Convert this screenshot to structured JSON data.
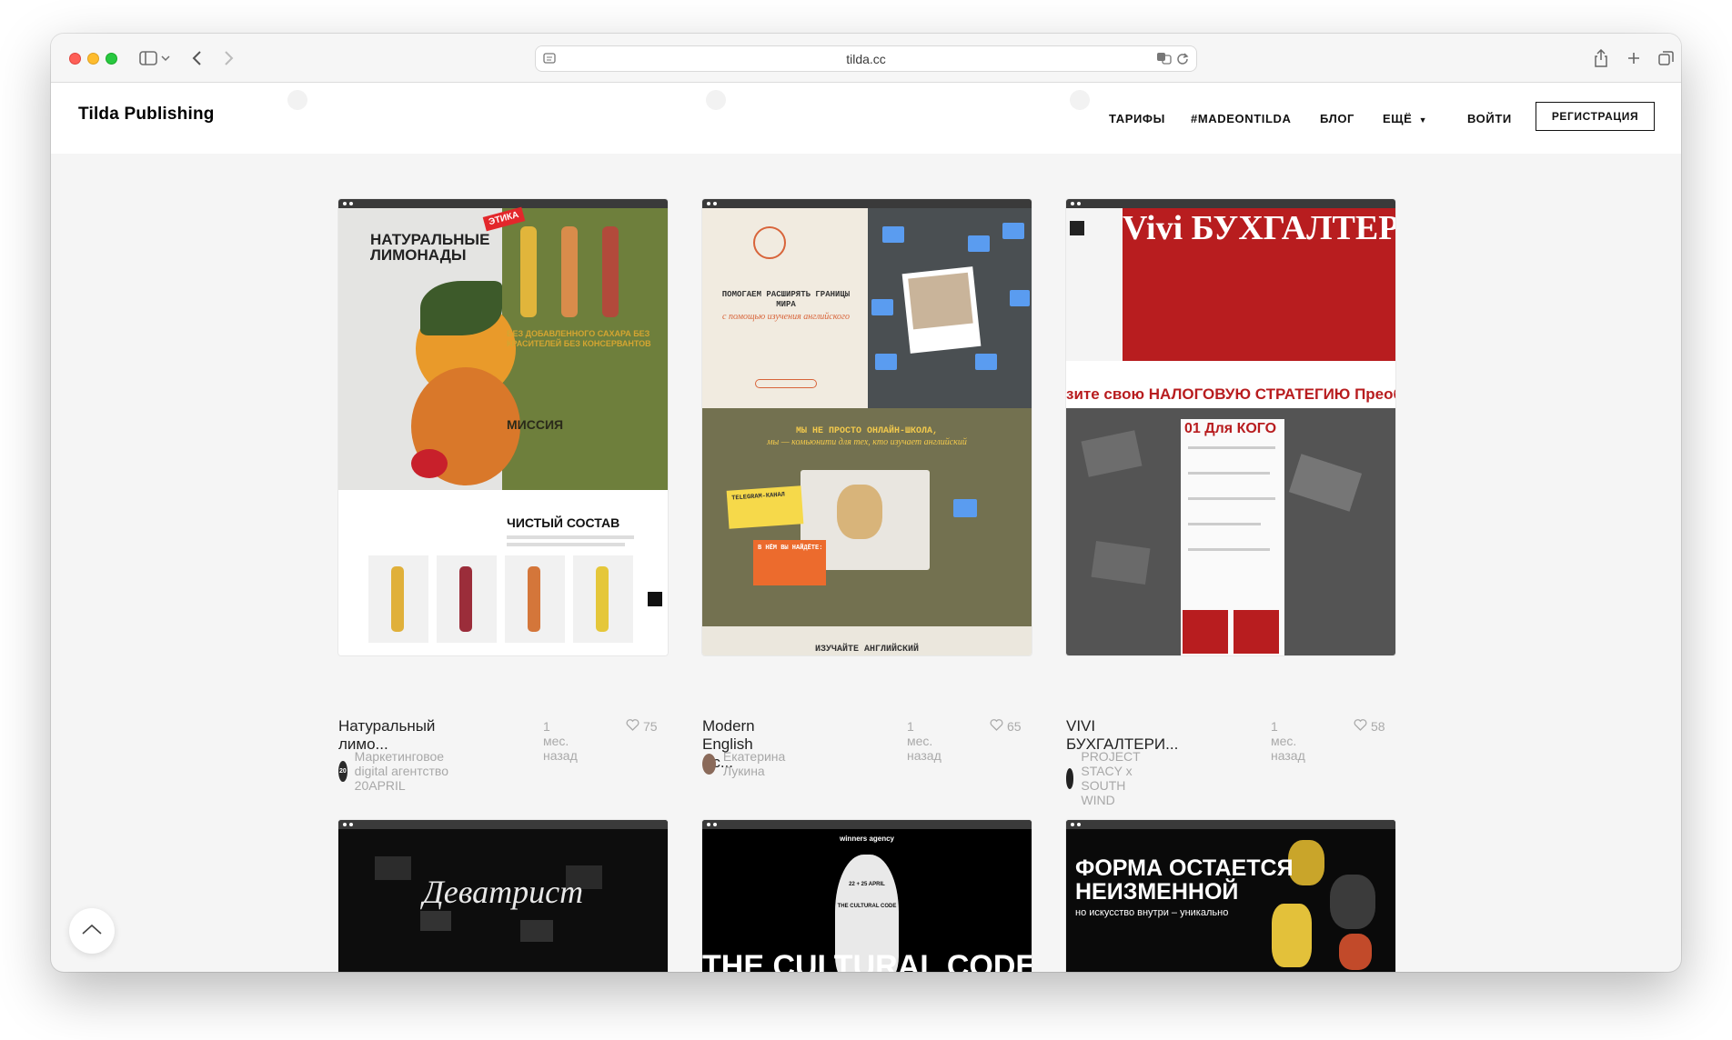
{
  "browser": {
    "url": "tilda.cc"
  },
  "site": {
    "logo": "Tilda Publishing",
    "nav": {
      "pricing": "ТАРИФЫ",
      "madeontilda": "#MADEONTILDA",
      "blog": "БЛОГ",
      "more": "ЕЩЁ",
      "login": "ВОЙТИ",
      "register": "РЕГИСТРАЦИЯ"
    }
  },
  "cards": [
    {
      "title": "Натуральный лимо...",
      "time": "1 мес. назад",
      "likes": "75",
      "author": "Маркетинговое digital агентство 20APRIL",
      "avatar_text": "20",
      "preview": {
        "heading": "НАТУРАЛЬНЫЕ ЛИМОНАДЫ",
        "brand": "ЭТИКА",
        "tagline": "БЕЗ ДОБАВЛЕННОГО САХАРА БЕЗ КРАСИТЕЛЕЙ БЕЗ КОНСЕРВАНТОВ",
        "mission": "МИССИЯ",
        "section": "ЧИСТЫЙ СОСТАВ"
      }
    },
    {
      "title": "Modern English Sc...",
      "time": "1 мес. назад",
      "likes": "65",
      "author": "Екатерина Лукина",
      "preview": {
        "heading": "ПОМОГАЕМ РАСШИРЯТЬ ГРАНИЦЫ МИРА",
        "subheading": "с помощью изучения английского",
        "mid_heading": "МЫ НЕ ПРОСТО ОНЛАЙН-ШКОЛА,",
        "mid_sub": "мы — комьюнити для тех, кто изучает английский",
        "sticky1": "TELEGRAM-КАНАЛ",
        "sticky2": "В НЁМ ВЫ НАЙДЁТЕ:",
        "footer": "ИЗУЧАЙТЕ АНГЛИЙСКИЙ"
      }
    },
    {
      "title": "VIVI БУХГАЛТЕРИ...",
      "time": "1 мес. назад",
      "likes": "58",
      "author": "PROJECT STACY x SOUTH WIND",
      "preview": {
        "heading": "Vivi БУХГАЛТЕРИ",
        "strategy": "зите свою НАЛОГОВУЮ СТРАТЕГИЮ Преобра",
        "section": "01 Для КОГО"
      }
    },
    {
      "preview": {
        "heading": "Деватрист"
      }
    },
    {
      "preview": {
        "heading": "winners agency",
        "date": "22 + 25 APRIL",
        "bottle": "THE CULTURAL CODE",
        "big": "THE CULTURAL CODE"
      }
    },
    {
      "preview": {
        "heading": "ФОРМА ОСТАЕТСЯ НЕИЗМЕННОЙ",
        "sub": "но искусство внутри – уникально"
      }
    }
  ]
}
